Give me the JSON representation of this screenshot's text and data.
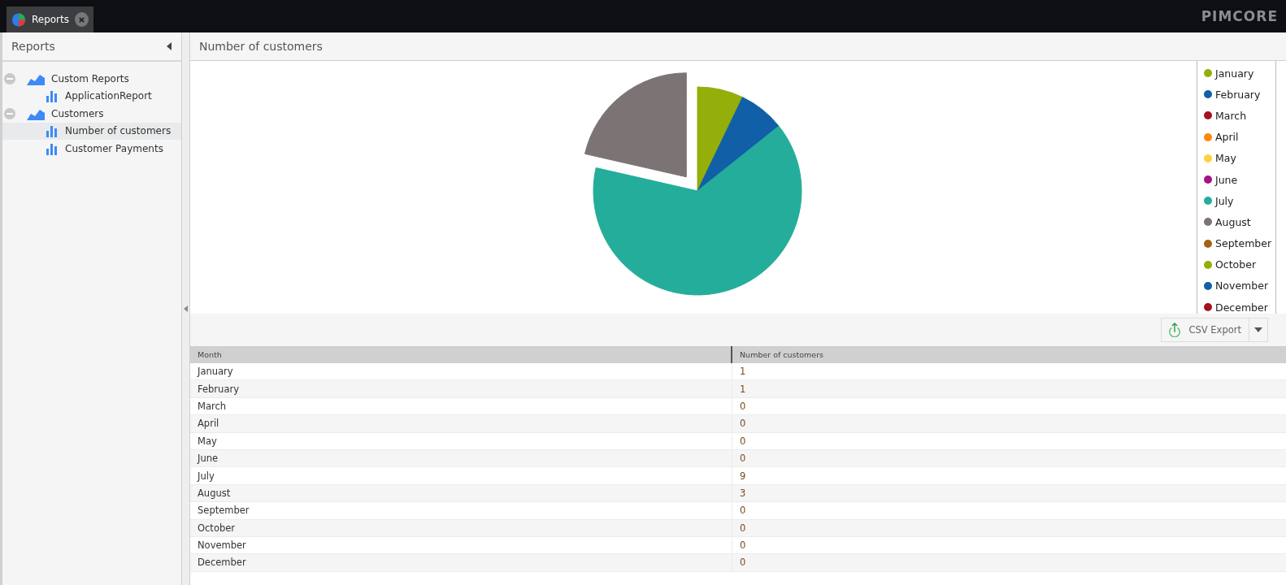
{
  "tabs": [
    {
      "label": "Reports",
      "selected": true
    }
  ],
  "logo": "PIMCORE",
  "sidebar": {
    "title": "Reports",
    "tree": [
      {
        "label": "Custom Reports",
        "kind": "group",
        "expanded": true,
        "selected": false,
        "children": [
          {
            "label": "ApplicationReport",
            "kind": "report",
            "selected": false
          }
        ]
      },
      {
        "label": "Customers",
        "kind": "group",
        "expanded": true,
        "selected": false,
        "children": [
          {
            "label": "Number of customers",
            "kind": "report",
            "selected": true
          },
          {
            "label": "Customer Payments",
            "kind": "report",
            "selected": false
          }
        ]
      }
    ]
  },
  "report": {
    "title": "Number of customers",
    "chart_data": {
      "type": "pie",
      "categories": [
        "January",
        "February",
        "March",
        "April",
        "May",
        "June",
        "July",
        "August",
        "September",
        "October",
        "November",
        "December"
      ],
      "values": [
        7.14,
        7.14,
        0,
        0,
        0,
        0,
        64.29,
        21.43,
        0,
        0,
        0,
        0
      ]
    },
    "legend": [
      {
        "color": "#94ae0a",
        "exploded": false
      },
      {
        "color": "#115fa6",
        "exploded": false
      },
      {
        "color": "#a61120"
      },
      {
        "color": "#ff8809"
      },
      {
        "color": "#ffd13e"
      },
      {
        "color": "#a61187"
      },
      {
        "color": "#24ad9a",
        "exploded": false
      },
      {
        "color": "#7c7474",
        "exploded": true
      },
      {
        "color": "#a66111"
      },
      {
        "color": "#94ae0a"
      },
      {
        "color": "#115fa6"
      },
      {
        "color": "#a61120"
      }
    ],
    "export_button": "CSV Export",
    "table": {
      "columns": [
        "Month",
        "Number of customers"
      ],
      "rows": [
        [
          "January",
          "1"
        ],
        [
          "February",
          "1"
        ],
        [
          "March",
          "0"
        ],
        [
          "April",
          "0"
        ],
        [
          "May",
          "0"
        ],
        [
          "June",
          "0"
        ],
        [
          "July",
          "9"
        ],
        [
          "August",
          "3"
        ],
        [
          "September",
          "0"
        ],
        [
          "October",
          "0"
        ],
        [
          "November",
          "0"
        ],
        [
          "December",
          "0"
        ]
      ]
    }
  }
}
